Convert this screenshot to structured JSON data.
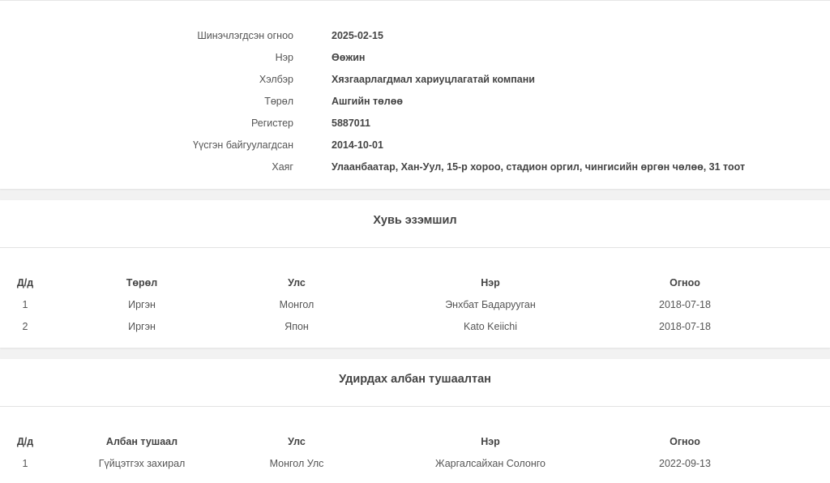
{
  "info": {
    "rows": [
      {
        "label": "Шинэчлэгдсэн огноо",
        "value": "2025-02-15"
      },
      {
        "label": "Нэр",
        "value": "Өөжин"
      },
      {
        "label": "Хэлбэр",
        "value": "Хязгаарлагдмал хариуцлагатай компани"
      },
      {
        "label": "Төрөл",
        "value": "Ашгийн төлөө"
      },
      {
        "label": "Регистер",
        "value": "5887011"
      },
      {
        "label": "Үүсгэн байгуулагдсан",
        "value": "2014-10-01"
      },
      {
        "label": "Хаяг",
        "value": "Улаанбаатар, Хан-Уул, 15-р хороо, стадион оргил, чингисийн өргөн чөлөө, 31 тоот"
      }
    ]
  },
  "ownership": {
    "title": "Хувь эзэмшил",
    "headers": [
      "Д/д",
      "Төрөл",
      "Улс",
      "Нэр",
      "Огноо"
    ],
    "rows": [
      [
        "1",
        "Иргэн",
        "Монгол",
        "Энхбат Бадарууган",
        "2018-07-18"
      ],
      [
        "2",
        "Иргэн",
        "Япон",
        "Kato Keiichi",
        "2018-07-18"
      ]
    ]
  },
  "management": {
    "title": "Удирдах албан тушаалтан",
    "headers": [
      "Д/д",
      "Албан тушаал",
      "Улс",
      "Нэр",
      "Огноо"
    ],
    "rows": [
      [
        "1",
        "Гүйцэтгэх захирал",
        "Монгол Улс",
        "Жаргалсайхан Солонго",
        "2022-09-13"
      ]
    ]
  }
}
